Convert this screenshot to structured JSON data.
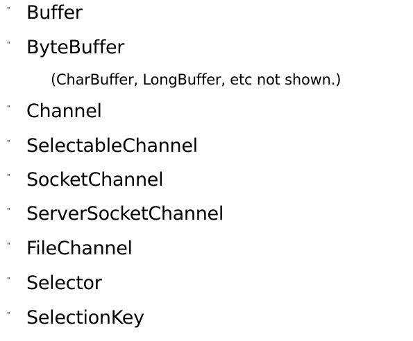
{
  "bullet_glyph": "\"",
  "items": [
    {
      "label": "Buffer"
    },
    {
      "label": "ByteBuffer"
    },
    {
      "label": "Channel"
    },
    {
      "label": "SelectableChannel"
    },
    {
      "label": "SocketChannel"
    },
    {
      "label": "ServerSocketChannel"
    },
    {
      "label": "FileChannel"
    },
    {
      "label": "Selector"
    },
    {
      "label": "SelectionKey"
    }
  ],
  "note": "(CharBuffer, LongBuffer, etc not shown.)"
}
